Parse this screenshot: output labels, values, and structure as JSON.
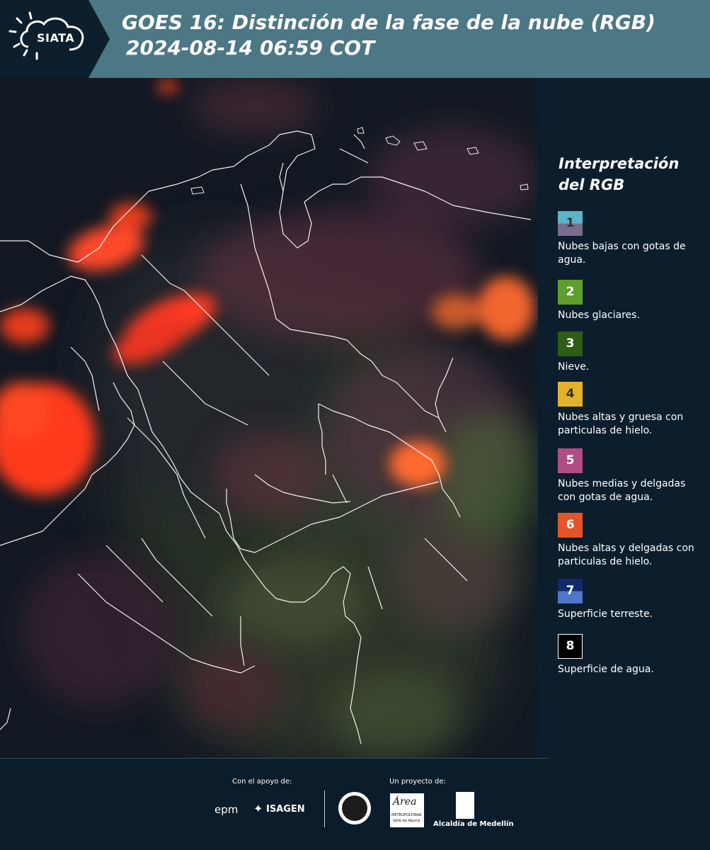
{
  "header": {
    "logo_text": "SIATA",
    "title_line1": "GOES 16: Distinción de la fase de la nube (RGB)",
    "title_line2": "2024-08-14 06:59 COT",
    "background_color": "#4c7784"
  },
  "legend": {
    "title": "Interpretación del RGB",
    "items": [
      {
        "number": "1",
        "label": "Nubes bajas con gotas de agua.",
        "colors": [
          "#5fb3c6",
          "#7a6c8e"
        ]
      },
      {
        "number": "2",
        "label": "Nubes glaciares.",
        "colors": [
          "#5e9e2c"
        ]
      },
      {
        "number": "3",
        "label": "Nieve.",
        "colors": [
          "#2d5d17"
        ]
      },
      {
        "number": "4",
        "label": "Nubes altas y gruesa con particulas de hielo.",
        "colors": [
          "#e3b22b"
        ]
      },
      {
        "number": "5",
        "label": "Nubes medias y delgadas con gotas de agua.",
        "colors": [
          "#b14d86"
        ]
      },
      {
        "number": "6",
        "label": "Nubes altas y delgadas con particulas de hielo.",
        "colors": [
          "#e3542a"
        ]
      },
      {
        "number": "7",
        "label": "Superficie terreste.",
        "colors": [
          "#102a6d",
          "#4e77c8"
        ]
      },
      {
        "number": "8",
        "label": "Superficie de agua.",
        "colors": [
          "#000000"
        ]
      }
    ]
  },
  "footer": {
    "support_label": "Con el apoyo de:",
    "project_label": "Un proyecto de:",
    "sponsor_epm": "epm",
    "sponsor_isagen": "ISAGEN",
    "area_logo": "Área",
    "area_sub1": "METROPOLITANA",
    "area_sub2": "Valle de Aburrá",
    "alcaldia": "Alcaldía de Medellín"
  }
}
